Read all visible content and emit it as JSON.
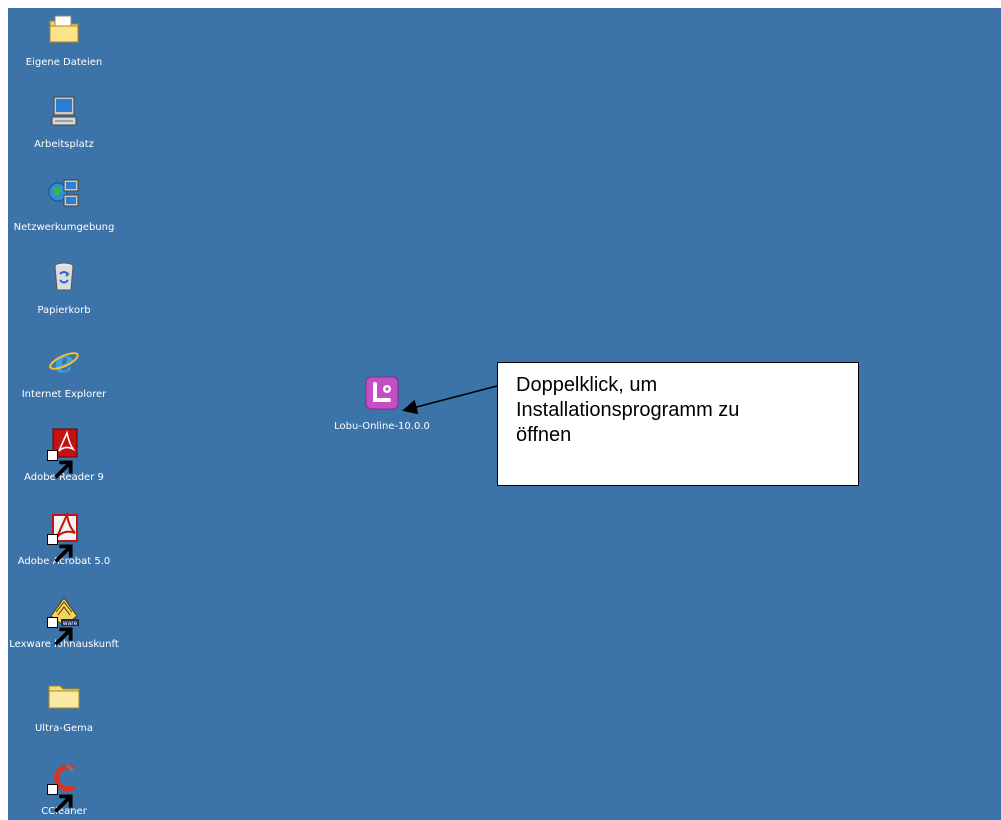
{
  "desktop": {
    "background_color": "#3c73a8",
    "icons": [
      {
        "label": "Eigene Dateien",
        "icon": "my-documents-folder-icon"
      },
      {
        "label": "Arbeitsplatz",
        "icon": "my-computer-icon"
      },
      {
        "label": "Netzwerkumgebung",
        "icon": "network-places-icon"
      },
      {
        "label": "Papierkorb",
        "icon": "recycle-bin-icon"
      },
      {
        "label": "Internet Explorer",
        "icon": "internet-explorer-icon"
      },
      {
        "label": "Adobe Reader 9",
        "icon": "adobe-reader-icon"
      },
      {
        "label": "Adobe Acrobat 5.0",
        "icon": "adobe-acrobat-icon"
      },
      {
        "label": "Lexware lohnauskunft",
        "icon": "lexware-icon"
      },
      {
        "label": "Ultra-Gema",
        "icon": "folder-icon"
      },
      {
        "label": "CCleaner",
        "icon": "ccleaner-icon"
      }
    ],
    "installer_icon": {
      "label": "Lobu-Online-10.0.0",
      "icon": "lobu-installer-icon",
      "color": "#c44ec4"
    }
  },
  "callout": {
    "lines": [
      "Doppelklick, um",
      "Installationsprogramm zu",
      "öffnen"
    ]
  }
}
